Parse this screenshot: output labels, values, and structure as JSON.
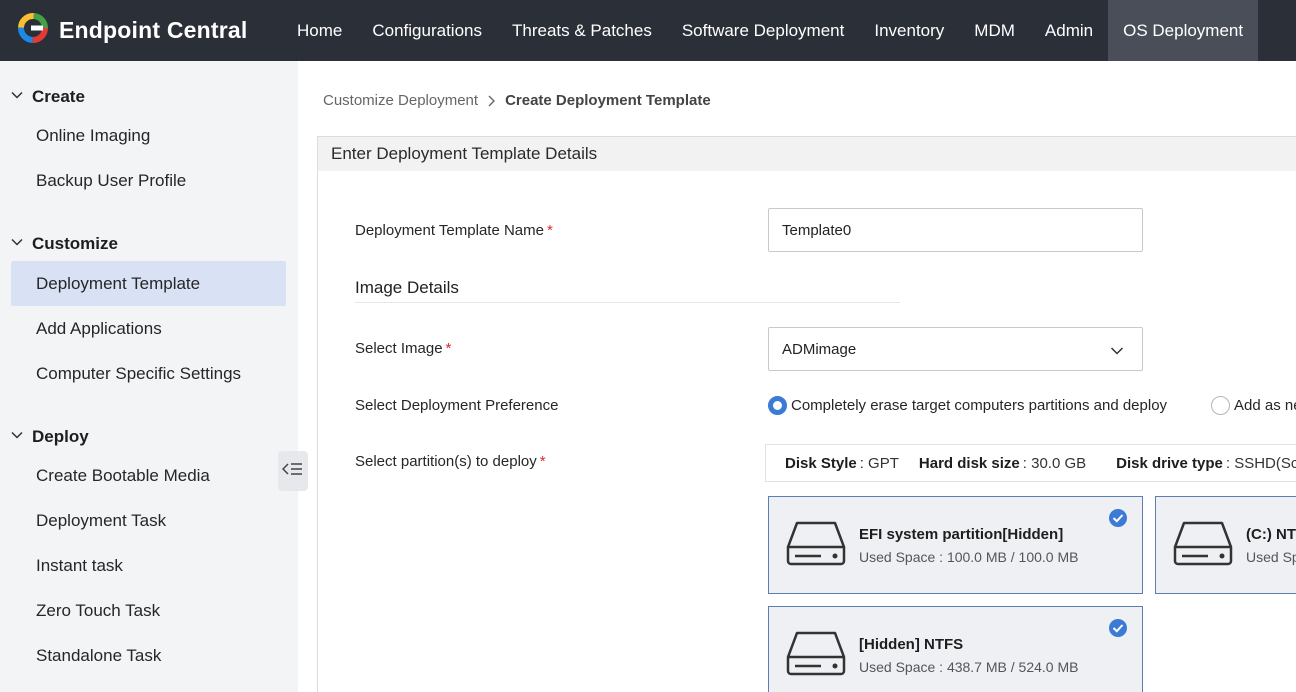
{
  "app": {
    "brand_name": "Endpoint Central",
    "brand_colors": [
      "#e53935",
      "#1e88e5",
      "#fbc02d",
      "#43a047"
    ]
  },
  "nav": {
    "items": [
      "Home",
      "Configurations",
      "Threats & Patches",
      "Software Deployment",
      "Inventory",
      "MDM",
      "Admin",
      "OS Deployment"
    ],
    "active": "OS Deployment"
  },
  "sidebar": {
    "sections": [
      {
        "label": "Create",
        "items": [
          "Online Imaging",
          "Backup User Profile"
        ]
      },
      {
        "label": "Customize",
        "items": [
          "Deployment Template",
          "Add Applications",
          "Computer Specific Settings"
        ]
      },
      {
        "label": "Deploy",
        "items": [
          "Create Bootable Media",
          "Deployment Task",
          "Instant task",
          "Zero Touch Task",
          "Standalone Task"
        ]
      }
    ],
    "active_item": "Deployment Template"
  },
  "breadcrumb": {
    "parent": "Customize Deployment",
    "current": "Create Deployment Template"
  },
  "form": {
    "panel_title": "Enter Deployment Template Details",
    "template_name_label": "Deployment Template Name",
    "template_name_value": "Template0",
    "image_details_title": "Image Details",
    "select_image_label": "Select Image",
    "select_image_value": "ADMimage",
    "preference_label": "Select Deployment Preference",
    "preference_options": [
      "Completely erase target computers partitions and deploy",
      "Add as ne"
    ],
    "preference_selected": 0,
    "partitions_label": "Select partition(s) to deploy",
    "required_mark": "*"
  },
  "disk": {
    "style_key": "Disk Style",
    "style_value": ": GPT",
    "size_key": "Hard disk size",
    "size_value": ": 30.0 GB",
    "type_key": "Disk drive type",
    "type_value": ": SSHD(Sc"
  },
  "partitions": [
    {
      "title": "EFI system partition[Hidden]",
      "sub": "Used Space : 100.0 MB / 100.0 MB",
      "checked": true
    },
    {
      "title": "(C:) NTF",
      "sub": "Used Sp",
      "checked": false
    },
    {
      "title": "[Hidden] NTFS",
      "sub": "Used Space : 438.7 MB / 524.0 MB",
      "checked": true
    }
  ],
  "accent_color": "#3b7bd6"
}
